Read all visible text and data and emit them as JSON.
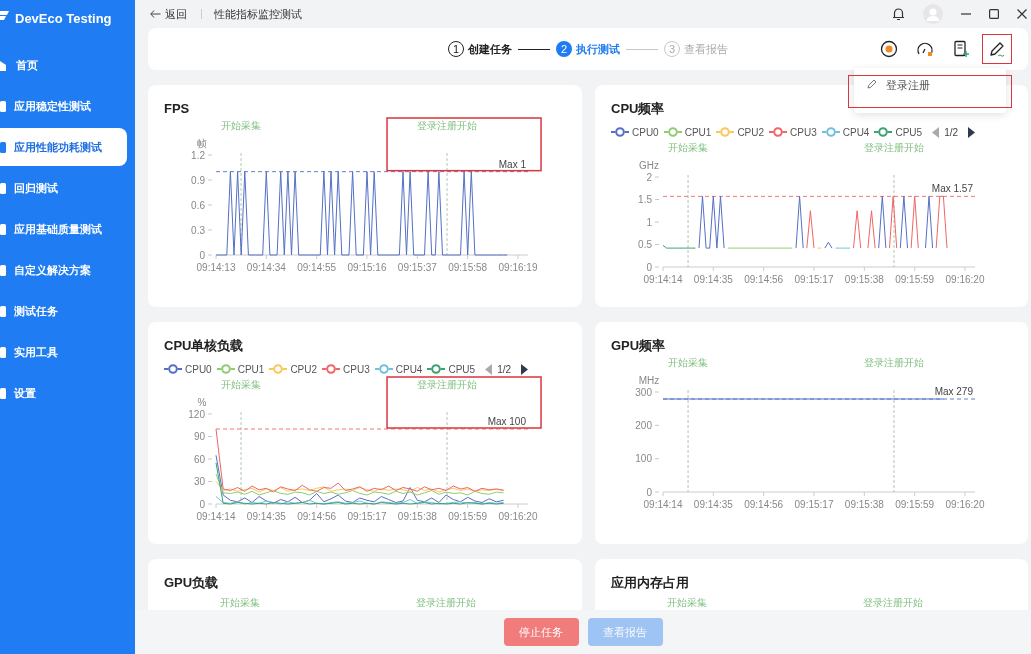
{
  "sidebar": {
    "app_name": "DevEco Testing",
    "items": [
      {
        "label": "首页",
        "selected": false
      },
      {
        "label": "应用稳定性测试",
        "selected": false
      },
      {
        "label": "应用性能功耗测试",
        "selected": true
      },
      {
        "label": "回归测试",
        "selected": false
      },
      {
        "label": "应用基础质量测试",
        "selected": false
      },
      {
        "label": "自定义解决方案",
        "selected": false
      },
      {
        "label": "测试任务",
        "selected": false
      },
      {
        "label": "实用工具",
        "selected": false
      },
      {
        "label": "设置",
        "selected": false
      }
    ]
  },
  "topbar": {
    "back": "返回",
    "title": "性能指标监控测试"
  },
  "steps": [
    {
      "number": "1",
      "label": "创建任务",
      "completed": true,
      "selected": false
    },
    {
      "number": "2",
      "label": "执行测试",
      "completed": false,
      "selected": true
    },
    {
      "number": "3",
      "label": "查看报告",
      "completed": false,
      "selected": false
    }
  ],
  "toolbar": [
    {
      "kind": "record",
      "highlighted": false
    },
    {
      "kind": "gauge",
      "highlighted": false
    },
    {
      "kind": "document-add",
      "highlighted": false
    },
    {
      "kind": "pen",
      "highlighted": true
    }
  ],
  "menu": {
    "items": [
      {
        "label": "登录注册",
        "highlighted": true
      }
    ]
  },
  "cards": [
    {
      "kind": "chart",
      "title": "FPS",
      "highlighted": true,
      "chart_data": {
        "type": "line",
        "ylabel": "帧",
        "ylim": [
          0,
          1.2
        ],
        "categories": [
          "09:14:13",
          null,
          null,
          null,
          null,
          null,
          null,
          null,
          null,
          null,
          null,
          null,
          null,
          null,
          "09:14:34",
          null,
          null,
          null,
          null,
          null,
          null,
          null,
          null,
          null,
          null,
          null,
          null,
          null,
          "09:14:55",
          null,
          null,
          null,
          null,
          null,
          null,
          null,
          null,
          null,
          null,
          null,
          null,
          null,
          "09:15:16",
          null,
          null,
          null,
          null,
          null,
          null,
          null,
          null,
          null,
          null,
          null,
          null,
          null,
          "09:15:37",
          null,
          null,
          null,
          null,
          null,
          null,
          null,
          null,
          null,
          null,
          null,
          null,
          null,
          "09:15:58",
          null,
          null,
          null,
          null,
          null,
          null,
          null,
          null,
          null,
          null,
          null,
          null,
          null,
          "09:16:19"
        ],
        "yticks": [
          0,
          0.3,
          0.6,
          0.9,
          1.2
        ],
        "series": [
          {
            "color": "#5470c6",
            "values": [
              0,
              0,
              0,
              0,
              1,
              0,
              1,
              0,
              1,
              0,
              0,
              0,
              0,
              0,
              1,
              0,
              0,
              0,
              1,
              0,
              1,
              0,
              1,
              0,
              0,
              0,
              0,
              0,
              0,
              0,
              1,
              0,
              1,
              0,
              1,
              0,
              0,
              0,
              1,
              0,
              0,
              0,
              1,
              0,
              1,
              0,
              0,
              0,
              0,
              0,
              0,
              0,
              1,
              0,
              1,
              0,
              0,
              0,
              0,
              1,
              0,
              0,
              1,
              0,
              0,
              0,
              0,
              0,
              0,
              1,
              0,
              1,
              0,
              0,
              0,
              0,
              0,
              0,
              0,
              0,
              0,
              0,
              null,
              null,
              null
            ]
          }
        ],
        "annotations": [
          "开始采集",
          "登录注册开始"
        ],
        "ref_lines": [
          {
            "axis": "y",
            "value": 1,
            "label": "Max 1"
          }
        ]
      }
    },
    {
      "kind": "chart",
      "title": "CPU频率",
      "highlighted": false,
      "legend_page": "1/2",
      "chart_data": {
        "type": "line",
        "ylabel": "GHz",
        "ylim": [
          0,
          2
        ],
        "categories": [
          "09:14:14",
          null,
          null,
          null,
          null,
          null,
          null,
          null,
          null,
          null,
          null,
          null,
          null,
          null,
          "09:14:35",
          null,
          null,
          null,
          null,
          null,
          null,
          null,
          null,
          null,
          null,
          null,
          null,
          null,
          "09:14:56",
          null,
          null,
          null,
          null,
          null,
          null,
          null,
          null,
          null,
          null,
          null,
          null,
          null,
          "09:15:17",
          null,
          null,
          null,
          null,
          null,
          null,
          null,
          null,
          null,
          null,
          null,
          null,
          null,
          "09:15:38",
          null,
          null,
          null,
          null,
          null,
          null,
          null,
          null,
          null,
          null,
          null,
          null,
          null,
          "09:15:59",
          null,
          null,
          null,
          null,
          null,
          null,
          null,
          null,
          null,
          null,
          null,
          null,
          null,
          "09:16:20"
        ],
        "yticks": [
          0,
          0.5,
          1,
          1.5,
          2
        ],
        "series": [
          {
            "name": "CPU0",
            "color": "#5470c6",
            "values": [
              null,
              null,
              null,
              null,
              null,
              null,
              null,
              null,
              null,
              null,
              0.42,
              1.57,
              0.42,
              0.42,
              1.57,
              0.42,
              1.57,
              0.42,
              null,
              null,
              null,
              null,
              null,
              null,
              null,
              null,
              null,
              null,
              null,
              null,
              null,
              null,
              null,
              null,
              null,
              null,
              null,
              0.42,
              1.57,
              0.42,
              null,
              null,
              null,
              null,
              null,
              0.42,
              0.55,
              0.42,
              null,
              null,
              null,
              null,
              null,
              null,
              null,
              null,
              null,
              null,
              null,
              null,
              0.42,
              1.57,
              0.42,
              null,
              null,
              null,
              0.42,
              1.57,
              0.42,
              null,
              null,
              null,
              null,
              0.42,
              1.57,
              0.42,
              null,
              null,
              null,
              null,
              null,
              null,
              null,
              null,
              null
            ]
          },
          {
            "name": "CPU1",
            "color": "#91cc75",
            "values": [
              null,
              null,
              null,
              null,
              null,
              null,
              null,
              null,
              null,
              null,
              null,
              null,
              null,
              null,
              null,
              null,
              null,
              null,
              0.42,
              0.42,
              0.42,
              0.42,
              0.42,
              0.42,
              0.42,
              0.42,
              0.42,
              0.42,
              0.42,
              0.42,
              0.42,
              0.42,
              0.42,
              0.42,
              0.42,
              0.42,
              0.42,
              null,
              null,
              null,
              null,
              null,
              null,
              null,
              null,
              null,
              null,
              null,
              null,
              null,
              null,
              null,
              null,
              null,
              null,
              null,
              null,
              null,
              null,
              null,
              null,
              null,
              null,
              null,
              null,
              null,
              null,
              null,
              null,
              null,
              null,
              null,
              null,
              null,
              null,
              null,
              null,
              null,
              null,
              null,
              null,
              null,
              null,
              null,
              null
            ]
          },
          {
            "name": "CPU2",
            "color": "#fac858",
            "values": [
              null,
              null,
              null,
              null,
              null,
              null,
              null,
              null,
              null,
              null,
              null,
              null,
              null,
              null,
              null,
              null,
              null,
              null,
              null,
              null,
              null,
              null,
              null,
              null,
              null,
              null,
              null,
              null,
              null,
              null,
              null,
              null,
              null,
              null,
              null,
              null,
              null,
              null,
              null,
              null,
              null,
              null,
              null,
              0.42,
              0.42,
              null,
              null,
              null,
              null,
              null,
              null,
              null,
              null,
              null,
              null,
              null,
              null,
              null,
              null,
              null,
              null,
              null,
              null,
              null,
              null,
              null,
              null,
              null,
              null,
              null,
              null,
              null,
              null,
              null,
              null,
              null,
              null,
              null,
              null,
              null,
              null,
              null,
              null,
              null,
              null
            ]
          },
          {
            "name": "CPU3",
            "color": "#ee6666",
            "values": [
              null,
              null,
              null,
              null,
              null,
              null,
              null,
              null,
              null,
              null,
              null,
              null,
              null,
              null,
              null,
              null,
              null,
              null,
              null,
              null,
              null,
              null,
              null,
              null,
              null,
              null,
              null,
              null,
              null,
              null,
              null,
              null,
              null,
              null,
              null,
              null,
              null,
              null,
              null,
              null,
              0.42,
              1.25,
              0.42,
              null,
              null,
              null,
              null,
              null,
              null,
              null,
              null,
              null,
              null,
              0.42,
              1.25,
              0.42,
              null,
              0.42,
              1.25,
              0.42,
              null,
              null,
              null,
              0.42,
              1.57,
              0.42,
              null,
              null,
              null,
              0.42,
              1.57,
              0.42,
              null,
              null,
              null,
              null,
              0.42,
              1.57,
              1.57,
              0.42,
              null,
              null,
              null,
              null,
              null
            ]
          },
          {
            "name": "CPU4",
            "color": "#73c0de",
            "values": [
              null,
              null,
              null,
              null,
              null,
              null,
              null,
              null,
              null,
              null,
              null,
              null,
              null,
              null,
              null,
              null,
              null,
              null,
              null,
              null,
              null,
              null,
              null,
              null,
              null,
              null,
              null,
              null,
              null,
              null,
              null,
              null,
              null,
              null,
              null,
              null,
              null,
              null,
              null,
              null,
              null,
              null,
              null,
              null,
              null,
              null,
              null,
              null,
              0.42,
              0.42,
              0.42,
              0.42,
              0.42,
              null,
              null,
              null,
              null,
              null,
              null,
              null,
              null,
              null,
              null,
              null,
              null,
              null,
              null,
              null,
              null,
              null,
              null,
              null,
              null,
              null,
              null,
              null,
              null,
              null,
              null,
              null,
              null,
              null,
              null,
              null,
              null
            ]
          },
          {
            "name": "CPU5",
            "color": "#3ba272",
            "values": [
              0.48,
              0.42,
              0.42,
              0.42,
              0.42,
              0.42,
              0.42,
              0.42,
              0.42,
              0.42,
              null,
              null,
              null,
              null,
              null,
              null,
              null,
              null,
              null,
              null,
              null,
              null,
              null,
              null,
              null,
              null,
              null,
              null,
              null,
              null,
              null,
              null,
              null,
              null,
              null,
              null,
              null,
              null,
              null,
              null,
              null,
              null,
              null,
              null,
              null,
              null,
              null,
              null,
              null,
              null,
              null,
              null,
              null,
              null,
              null,
              null,
              null,
              null,
              null,
              null,
              null,
              null,
              null,
              null,
              null,
              null,
              null,
              null,
              null,
              null,
              null,
              null,
              null,
              null,
              null,
              null,
              null,
              null,
              null,
              null,
              null,
              null,
              null,
              null,
              null
            ]
          }
        ],
        "annotations": [
          "开始采集",
          "登录注册开始"
        ],
        "ref_lines": [
          {
            "axis": "y",
            "value": 1.57,
            "label": "Max 1.57"
          }
        ]
      }
    },
    {
      "kind": "chart",
      "title": "CPU单核负载",
      "highlighted": true,
      "legend_page": "1/2",
      "chart_data": {
        "type": "line",
        "ylabel": "%",
        "ylim": [
          0,
          120
        ],
        "categories": [
          "09:14:14",
          null,
          null,
          null,
          null,
          null,
          null,
          "09:14:35",
          null,
          null,
          null,
          null,
          null,
          null,
          "09:14:56",
          null,
          null,
          null,
          null,
          null,
          null,
          "09:15:17",
          null,
          null,
          null,
          null,
          null,
          null,
          "09:15:38",
          null,
          null,
          null,
          null,
          null,
          null,
          "09:15:59",
          null,
          null,
          null,
          null,
          null,
          null,
          "09:16:20"
        ],
        "yticks": [
          0,
          30,
          60,
          90,
          120
        ],
        "series": [
          {
            "name": "CPU0",
            "color": "#5470c6",
            "values": [
              65,
              12,
              5,
              3,
              8,
              2,
              10,
              4,
              1,
              6,
              3,
              9,
              2,
              5,
              14,
              3,
              7,
              12,
              4,
              2,
              8,
              5,
              3,
              10,
              6,
              2,
              4,
              22,
              5,
              3,
              8,
              2,
              12,
              6,
              3,
              9,
              4,
              2,
              7,
              3,
              5,
              null,
              null
            ]
          },
          {
            "name": "CPU1",
            "color": "#91cc75",
            "values": [
              40,
              15,
              14,
              16,
              13,
              17,
              12,
              15,
              18,
              14,
              13,
              16,
              15,
              12,
              17,
              14,
              16,
              13,
              15,
              18,
              14,
              12,
              16,
              15,
              13,
              17,
              14,
              16,
              12,
              15,
              18,
              13,
              16,
              14,
              15,
              12,
              17,
              14,
              13,
              16,
              15,
              null,
              null
            ]
          },
          {
            "name": "CPU2",
            "color": "#fac858",
            "values": [
              30,
              18,
              20,
              17,
              19,
              21,
              16,
              20,
              18,
              22,
              17,
              19,
              20,
              18,
              21,
              23,
              17,
              19,
              20,
              18,
              22,
              19,
              17,
              21,
              18,
              20,
              19,
              17,
              22,
              18,
              20,
              16,
              19,
              21,
              18,
              20,
              17,
              19,
              18,
              20,
              19,
              null,
              null
            ]
          },
          {
            "name": "CPU3",
            "color": "#ee6666",
            "values": [
              100,
              20,
              18,
              22,
              17,
              24,
              19,
              21,
              16,
              23,
              20,
              18,
              25,
              19,
              17,
              22,
              21,
              28,
              18,
              20,
              23,
              17,
              21,
              19,
              24,
              18,
              22,
              20,
              17,
              23,
              19,
              21,
              18,
              24,
              20,
              22,
              17,
              21,
              19,
              20,
              18,
              null,
              null
            ]
          },
          {
            "name": "CPU4",
            "color": "#73c0de",
            "values": [
              10,
              2,
              1,
              3,
              0,
              2,
              1,
              4,
              2,
              0,
              3,
              1,
              2,
              5,
              1,
              0,
              2,
              3,
              1,
              2,
              4,
              1,
              0,
              3,
              2,
              1,
              2,
              6,
              1,
              3,
              2,
              0,
              1,
              2,
              3,
              1,
              2,
              0,
              2,
              1,
              2,
              null,
              null
            ]
          },
          {
            "name": "CPU5",
            "color": "#3ba272",
            "values": [
              55,
              1,
              0,
              2,
              1,
              0,
              1,
              0,
              2,
              1,
              0,
              1,
              2,
              0,
              1,
              0,
              1,
              2,
              0,
              1,
              0,
              1,
              0,
              2,
              1,
              0,
              1,
              0,
              1,
              2,
              0,
              1,
              0,
              1,
              0,
              2,
              1,
              0,
              1,
              0,
              1,
              null,
              null
            ]
          }
        ],
        "annotations": [
          "开始采集",
          "登录注册开始"
        ],
        "ref_lines": [
          {
            "axis": "y",
            "value": 100,
            "label": "Max 100"
          }
        ]
      }
    },
    {
      "kind": "chart",
      "title": "GPU频率",
      "highlighted": false,
      "chart_data": {
        "type": "line",
        "ylabel": "MHz",
        "ylim": [
          0,
          300
        ],
        "categories": [
          "09:14:14",
          null,
          null,
          null,
          null,
          null,
          null,
          "09:14:35",
          null,
          null,
          null,
          null,
          null,
          null,
          "09:14:56",
          null,
          null,
          null,
          null,
          null,
          null,
          "09:15:17",
          null,
          null,
          null,
          null,
          null,
          null,
          "09:15:38",
          null,
          null,
          null,
          null,
          null,
          null,
          "09:15:59",
          null,
          null,
          null,
          null,
          null,
          null,
          "09:16:20"
        ],
        "yticks": [
          0,
          100,
          200,
          300
        ],
        "series": [
          {
            "color": "#5470c6",
            "values": [
              279,
              279,
              279,
              279,
              279,
              279,
              279,
              279,
              279,
              279,
              279,
              279,
              279,
              279,
              279,
              279,
              279,
              279,
              279,
              279,
              279,
              279,
              279,
              279,
              279,
              279,
              279,
              279,
              279,
              279,
              279,
              279,
              279,
              279,
              279,
              279,
              279,
              279,
              279,
              279,
              null,
              null,
              null
            ]
          }
        ],
        "annotations": [
          "开始采集",
          "登录注册开始"
        ],
        "ref_lines": [
          {
            "axis": "y",
            "value": 279,
            "label": "Max 279"
          }
        ]
      }
    },
    {
      "kind": "partial",
      "title": "GPU负载",
      "event_labels": [
        "开始采集",
        "登录注册开始"
      ]
    },
    {
      "kind": "partial",
      "title": "应用内存占用",
      "event_labels": [
        "开始采集",
        "登录注册开始"
      ]
    }
  ],
  "footer": {
    "buttons": [
      {
        "label": "停止任务",
        "kind": "danger",
        "disabled": false
      },
      {
        "label": "查看报告",
        "kind": "primary",
        "disabled": true
      }
    ]
  }
}
